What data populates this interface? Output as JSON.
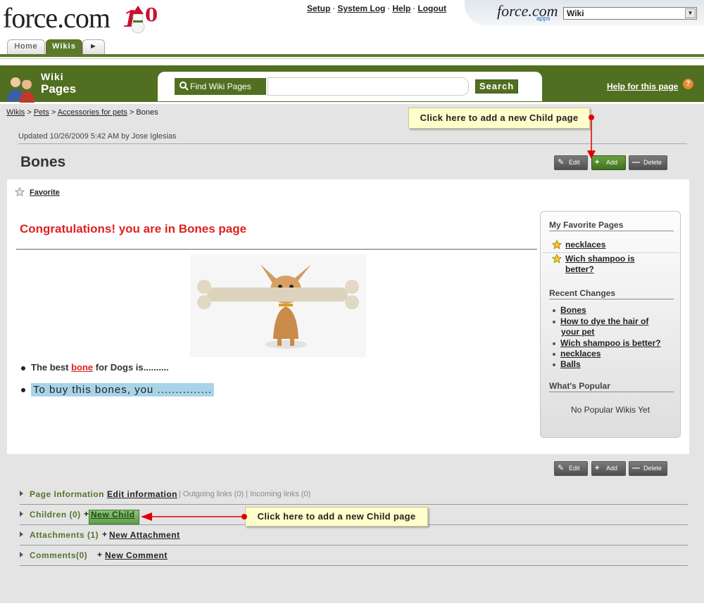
{
  "header": {
    "logo_text": "force.com",
    "top_links": [
      "Setup",
      "System Log",
      "Help",
      "Logout"
    ],
    "apps_logo": "force.com",
    "apps_sub": "apps",
    "app_selector": "Wiki",
    "tabs": [
      {
        "label": "Home",
        "active": false
      },
      {
        "label": "Wikis",
        "active": true
      }
    ]
  },
  "band": {
    "title_line1": "Wiki",
    "title_line2": "Pages",
    "search_label": "Find Wiki Pages",
    "search_value": "",
    "search_button": "Search",
    "help_link": "Help for this page",
    "help_icon": "?"
  },
  "breadcrumb": [
    "Wikis",
    "Pets",
    "Accessories for pets",
    "Bones"
  ],
  "breadcrumb_sep": " > ",
  "page": {
    "updated": "Updated 10/26/2009 5:42 AM by Jose Iglesias",
    "title": "Bones",
    "actions": {
      "edit": "Edit",
      "add": "Add",
      "delete": "Delete"
    },
    "favorite": "Favorite",
    "heading": "Congratulations! you are in Bones page",
    "bullet1_pre": "The best ",
    "bullet1_link": "bone",
    "bullet1_post": " for Dogs is..........",
    "bullet2": "To buy this bones, you ..............."
  },
  "sidebar": {
    "favorites_heading": "My Favorite Pages",
    "favorites": [
      "necklaces",
      "Wich shampoo is",
      "better?"
    ],
    "recent_heading": "Recent Changes",
    "recent": [
      "Bones",
      "How to dye the hair of",
      "your pet",
      "Wich shampoo is better?",
      "necklaces",
      "Balls"
    ],
    "popular_heading": "What's Popular",
    "popular_empty": "No Popular Wikis Yet"
  },
  "sections": {
    "page_info": "Page Information",
    "edit_info": "Edit information",
    "outgoing": "| Outgoing links (0) | Incoming links (0)",
    "children": "Children (0)",
    "new_child": "New Child",
    "attachments": "Attachments (1)",
    "new_attachment": "New Attachment",
    "comments": "Comments(0)",
    "new_comment": "New Comment",
    "plus": "+"
  },
  "callouts": {
    "top": "Click here to add a new Child page",
    "bottom": "Click here to add a new Child page"
  },
  "colors": {
    "brand_green": "#516f20",
    "section_green": "#58732c",
    "heading_red": "#e02020",
    "callout_bg": "#ffffcc",
    "arrow_red": "#e00000",
    "highlight_blue": "#a8d4e8"
  }
}
